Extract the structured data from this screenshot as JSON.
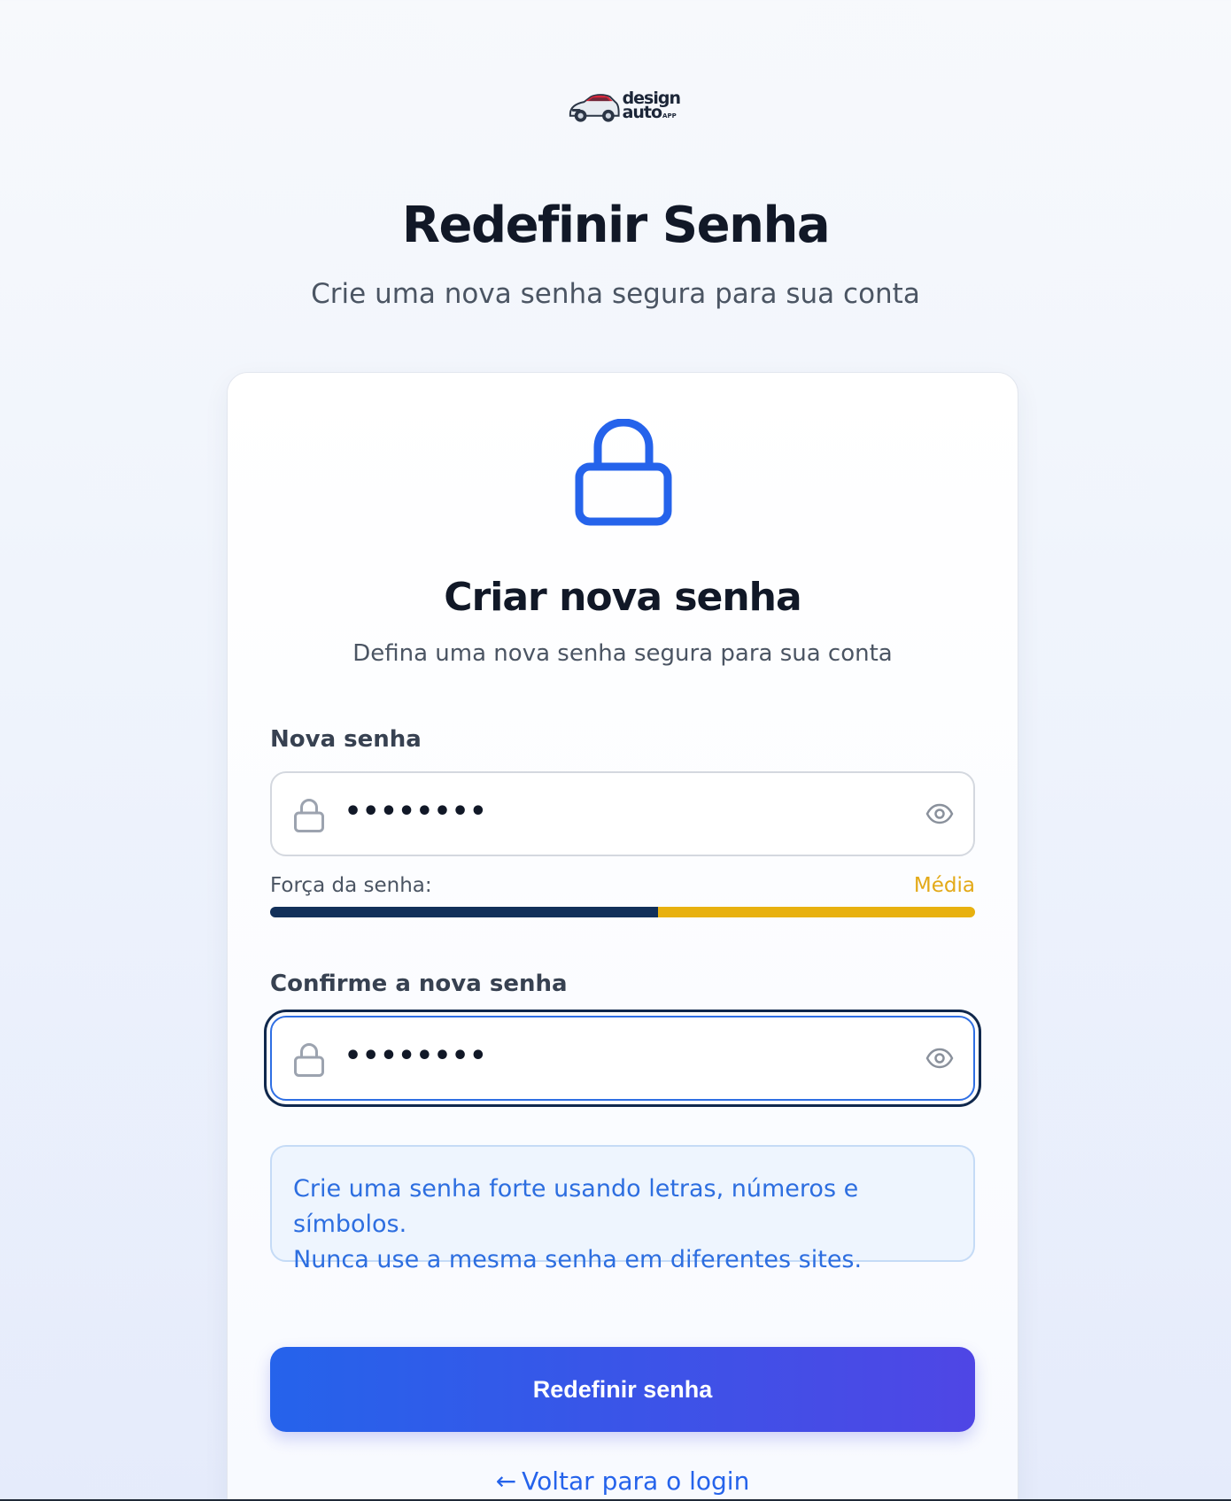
{
  "logo": {
    "line1": "design",
    "line2": "auto",
    "suffix": "APP"
  },
  "header": {
    "title": "Redefinir Senha",
    "subtitle": "Crie uma nova senha segura para sua conta"
  },
  "card": {
    "title": "Criar nova senha",
    "subtitle": "Defina uma nova senha segura para sua conta",
    "new_password": {
      "label": "Nova senha",
      "value": "••••••••"
    },
    "strength": {
      "label": "Força da senha:",
      "value_label": "Média",
      "level": 0.55,
      "colors": {
        "filled": "#12305a",
        "rest": "#e8b10f",
        "text": "#e3a917"
      }
    },
    "confirm_password": {
      "label": "Confirme a nova senha",
      "value": "••••••••"
    },
    "tip": {
      "line1": "Crie uma senha forte usando letras, números e símbolos.",
      "line2": "Nunca use a mesma senha em diferentes sites."
    },
    "submit_label": "Redefinir senha",
    "back_label": "Voltar para o login"
  },
  "icons": {
    "hero": "lock-icon",
    "field": "lock-icon",
    "toggle": "eye-icon",
    "back": "arrow-left-icon"
  },
  "colors": {
    "accent": "#2563eb",
    "button_gradient_end": "#4f46e5",
    "title": "#111827"
  }
}
